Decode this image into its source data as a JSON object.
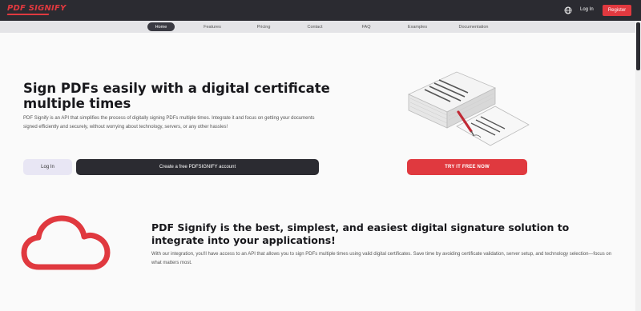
{
  "header": {
    "logo_text": "PDF SIGNIFY",
    "login_label": "Log In",
    "register_label": "Register",
    "globe_icon": "globe-icon",
    "brand_color": "#e0393f",
    "dark_color": "#2b2b31"
  },
  "nav": {
    "items": [
      {
        "label": "Home"
      },
      {
        "label": "Features"
      },
      {
        "label": "Pricing"
      },
      {
        "label": "Contact"
      },
      {
        "label": "FAQ"
      },
      {
        "label": "Examples"
      },
      {
        "label": "Documentation"
      }
    ]
  },
  "hero": {
    "title": "Sign PDFs easily with a digital certificate multiple times",
    "description": "PDF Signify is an API that simplifies the process of digitally signing PDFs multiple times. Integrate it and focus on getting your documents signed efficiently and securely, without worrying about technology, servers, or any other hassles!",
    "login_button": "Log In",
    "create_account_button": "Create a free PDFSIGNIFY account",
    "try_button": "TRY IT FREE NOW",
    "illustration_icon": "documents-pen-illustration"
  },
  "section": {
    "cloud_icon": "cloud-icon",
    "title": "PDF Signify is the best, simplest, and easiest digital signature solution to integrate into your applications!",
    "description": "With our integration, you'll have access to an API that allows you to sign PDFs multiple times using valid digital certificates. Save time by avoiding certificate validation, server setup, and technology selection—focus on what matters most."
  }
}
